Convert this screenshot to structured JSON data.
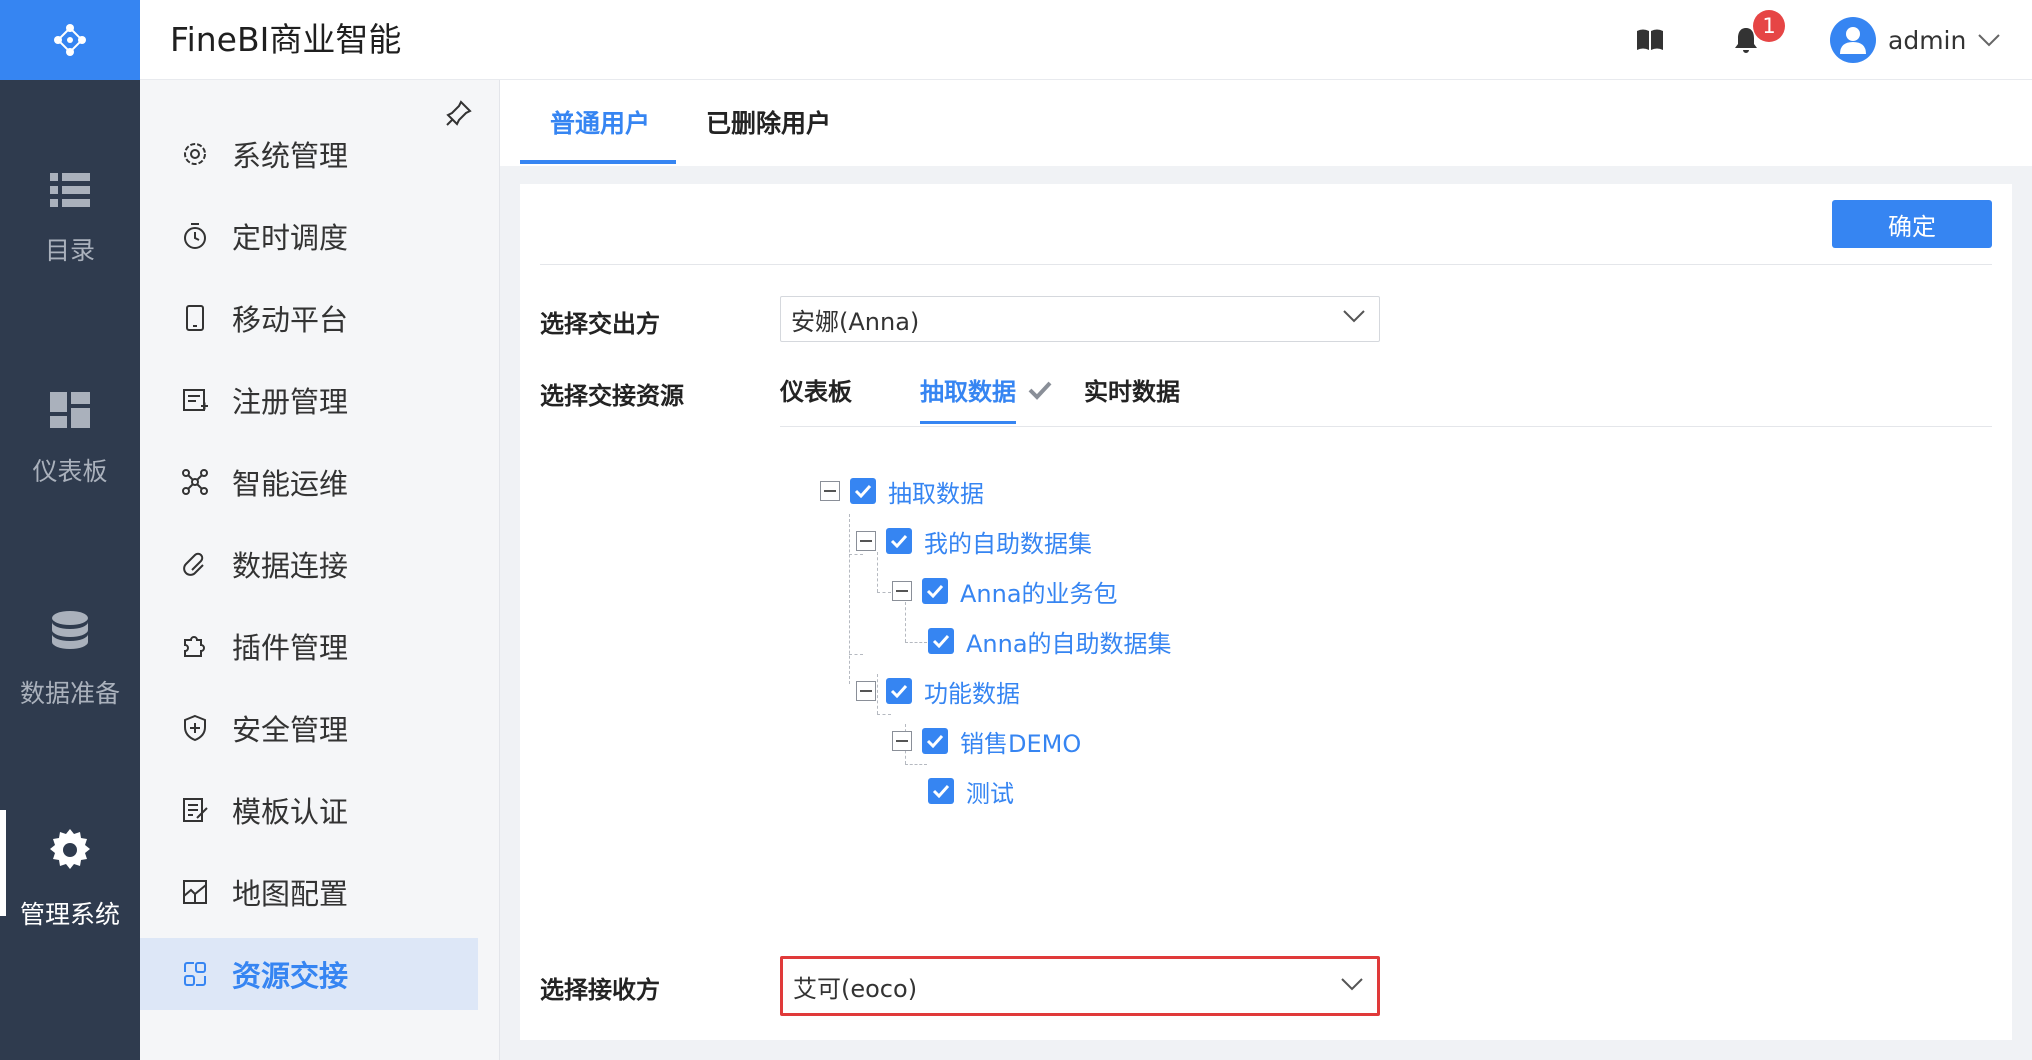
{
  "app": {
    "title": "FineBI商业智能"
  },
  "header": {
    "notification_count": "1",
    "username": "admin"
  },
  "rail": {
    "items": [
      {
        "label": "目录",
        "icon": "list-icon"
      },
      {
        "label": "仪表板",
        "icon": "dashboard-icon"
      },
      {
        "label": "数据准备",
        "icon": "database-icon"
      },
      {
        "label": "管理系统",
        "icon": "gear-icon"
      }
    ]
  },
  "sidenav": {
    "items": [
      {
        "label": "系统管理",
        "icon": "settings-icon"
      },
      {
        "label": "定时调度",
        "icon": "timer-icon"
      },
      {
        "label": "移动平台",
        "icon": "mobile-icon"
      },
      {
        "label": "注册管理",
        "icon": "register-icon"
      },
      {
        "label": "智能运维",
        "icon": "ops-icon"
      },
      {
        "label": "数据连接",
        "icon": "link-icon"
      },
      {
        "label": "插件管理",
        "icon": "plugin-icon"
      },
      {
        "label": "安全管理",
        "icon": "shield-icon"
      },
      {
        "label": "模板认证",
        "icon": "template-auth-icon"
      },
      {
        "label": "地图配置",
        "icon": "map-icon"
      },
      {
        "label": "资源交接",
        "icon": "transfer-icon"
      }
    ],
    "active_index": 10
  },
  "tabs": [
    {
      "label": "普通用户"
    },
    {
      "label": "已删除用户"
    }
  ],
  "form": {
    "confirm_label": "确定",
    "from_label": "选择交出方",
    "from_value": "安娜(Anna)",
    "resource_label": "选择交接资源",
    "resource_tabs": [
      {
        "label": "仪表板"
      },
      {
        "label": "抽取数据"
      },
      {
        "label": "实时数据"
      }
    ],
    "to_label": "选择接收方",
    "to_value": "艾可(eoco)"
  },
  "tree": [
    {
      "label": "抽取数据",
      "level": 0,
      "expanded": true,
      "checked": true
    },
    {
      "label": "我的自助数据集",
      "level": 1,
      "expanded": true,
      "checked": true
    },
    {
      "label": "Anna的业务包",
      "level": 2,
      "expanded": true,
      "checked": true
    },
    {
      "label": "Anna的自助数据集",
      "level": 3,
      "checked": true
    },
    {
      "label": "功能数据",
      "level": 1,
      "expanded": true,
      "checked": true
    },
    {
      "label": "销售DEMO",
      "level": 2,
      "expanded": true,
      "checked": true
    },
    {
      "label": "测试",
      "level": 3,
      "checked": true
    }
  ],
  "colors": {
    "accent": "#3685f2",
    "rail": "#2f3b4e",
    "highlight_border": "#e03a3a"
  }
}
